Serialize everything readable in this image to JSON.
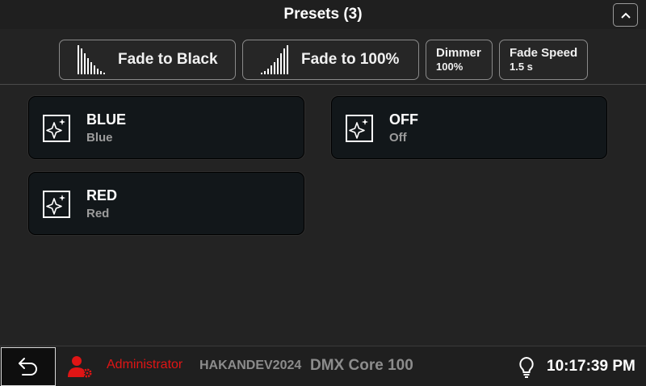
{
  "header": {
    "title": "Presets (3)",
    "collapse_icon": "chevron-up-icon"
  },
  "toolbar": {
    "fade_black": {
      "label": "Fade to Black",
      "icon": "bars-descending-icon"
    },
    "fade_full": {
      "label": "Fade to 100%",
      "icon": "bars-ascending-icon"
    },
    "dimmer": {
      "title": "Dimmer",
      "value": "100%"
    },
    "fade_speed": {
      "title": "Fade Speed",
      "value": "1.5 s"
    }
  },
  "presets": [
    {
      "name": "BLUE",
      "sub": "Blue",
      "icon": "sparkle-icon"
    },
    {
      "name": "OFF",
      "sub": "Off",
      "icon": "sparkle-icon"
    },
    {
      "name": "RED",
      "sub": "Red",
      "icon": "sparkle-icon"
    }
  ],
  "footer": {
    "user": "Administrator",
    "host": "HAKANDEV2024",
    "device": "DMX Core 100",
    "time": "10:17:39 PM",
    "user_color": "#e01515"
  }
}
